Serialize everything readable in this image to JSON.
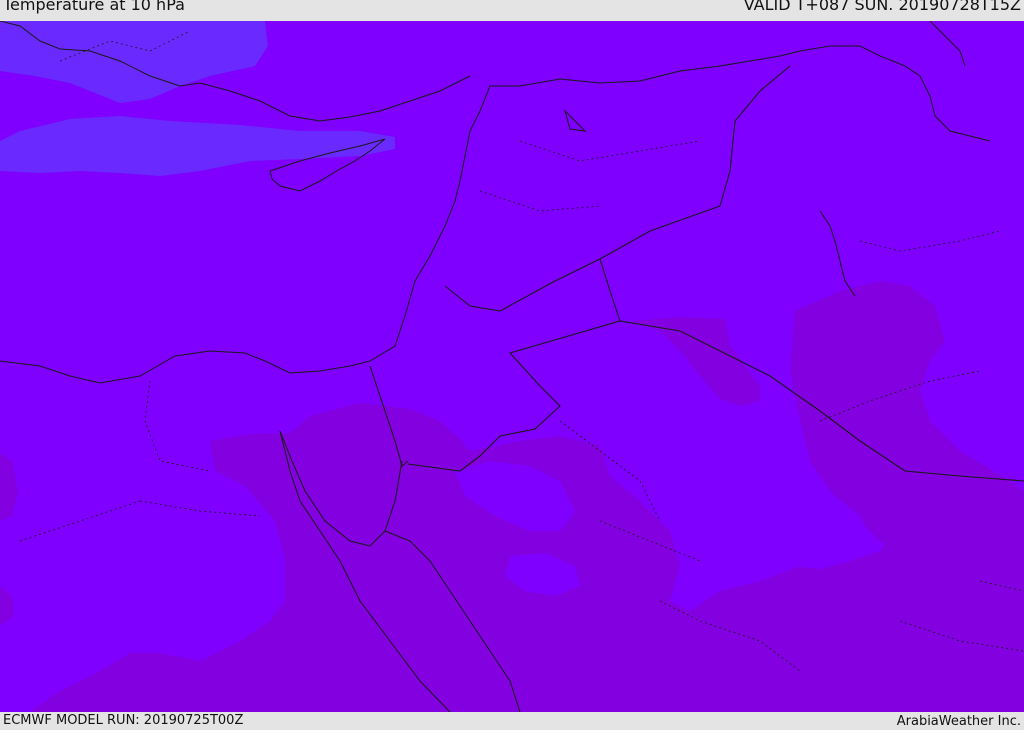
{
  "header": {
    "title": "Temperature at 10 hPa",
    "valid": "VALID T+087 SUN. 20190728T15Z"
  },
  "footer": {
    "model_run": "ECMWF MODEL RUN: 20190725T00Z",
    "credit": "ArabiaWeather Inc."
  },
  "map": {
    "region": "Eastern Mediterranean and Middle East",
    "colors": {
      "base": "#7f00ff",
      "cool": "#6a2aff",
      "warm": "#8300e0",
      "coastline": "#1a1a1a",
      "border": "#1a1a1a"
    }
  }
}
